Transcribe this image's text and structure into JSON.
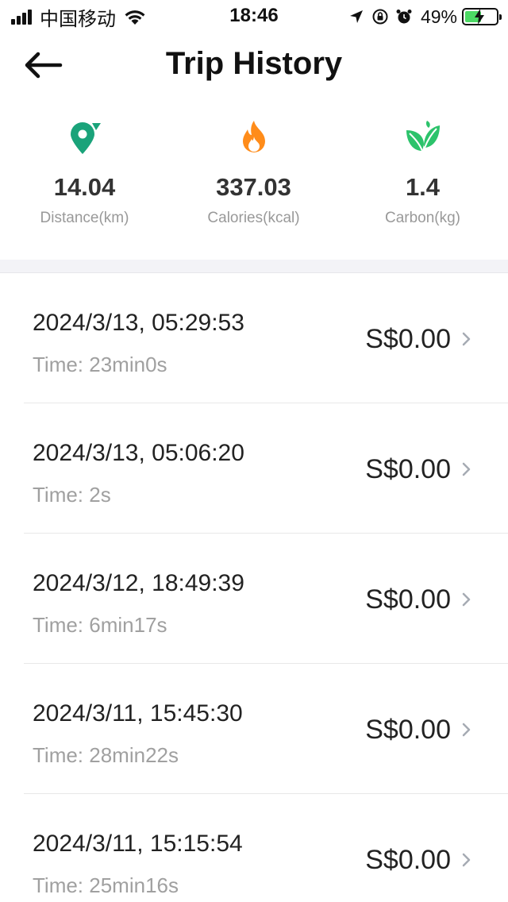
{
  "status_bar": {
    "carrier": "中国移动",
    "time": "18:46",
    "battery_percent": "49%"
  },
  "header": {
    "title": "Trip History",
    "back_icon": "arrow-left-icon"
  },
  "stats": [
    {
      "icon": "location-pin-icon",
      "value": "14.04",
      "label": "Distance(km)",
      "color": "#1aa37a"
    },
    {
      "icon": "flame-icon",
      "value": "337.03",
      "label": "Calories(kcal)",
      "color": "#ff8c1a"
    },
    {
      "icon": "leaf-icon",
      "value": "1.4",
      "label": "Carbon(kg)",
      "color": "#2cc36b"
    }
  ],
  "trips": [
    {
      "date": "2024/3/13, 05:29:53",
      "time": "Time: 23min0s",
      "price": "S$0.00"
    },
    {
      "date": "2024/3/13, 05:06:20",
      "time": "Time: 2s",
      "price": "S$0.00"
    },
    {
      "date": "2024/3/12, 18:49:39",
      "time": "Time: 6min17s",
      "price": "S$0.00"
    },
    {
      "date": "2024/3/11, 15:45:30",
      "time": "Time: 28min22s",
      "price": "S$0.00"
    },
    {
      "date": "2024/3/11, 15:15:54",
      "time": "Time: 25min16s",
      "price": "S$0.00"
    }
  ]
}
